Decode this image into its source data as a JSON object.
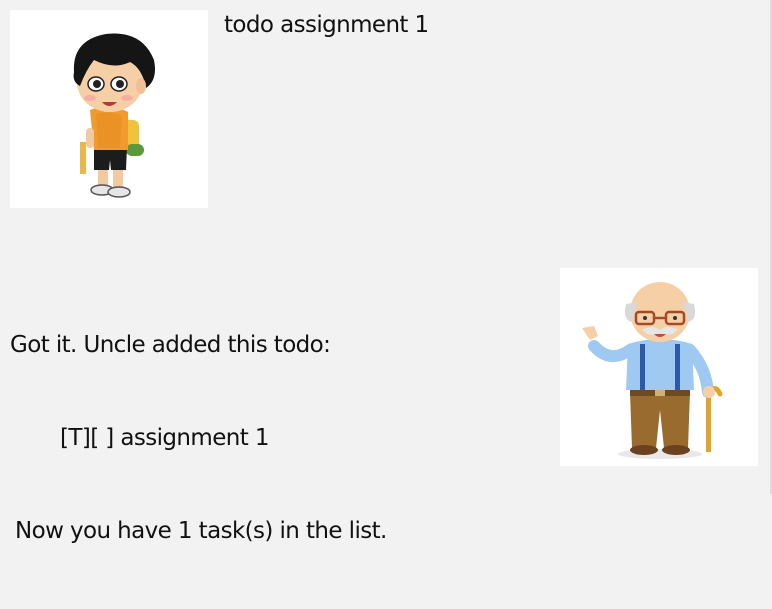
{
  "dialog": {
    "user": {
      "avatar_icon": "boy-with-backpack-avatar-icon",
      "text": "todo assignment 1"
    },
    "bot": {
      "avatar_icon": "old-man-with-cane-avatar-icon",
      "lines": [
        "Got it. Uncle added this todo:",
        "[T][ ] assignment 1",
        "Now you have 1 task(s) in the list."
      ]
    }
  },
  "colors": {
    "background": "#f2f2f2",
    "avatar_bg": "#ffffff",
    "text": "#111111"
  }
}
